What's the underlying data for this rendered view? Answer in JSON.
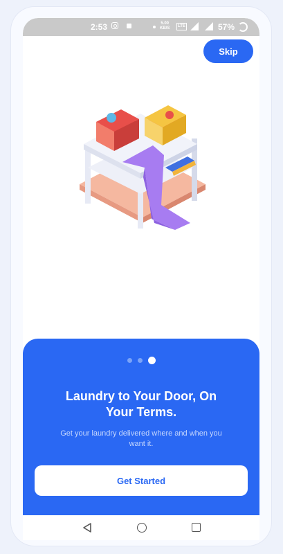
{
  "status_bar": {
    "time": "2:53",
    "net_speed": "5.00\nKB/S",
    "network": "LTE",
    "battery": "57%"
  },
  "header": {
    "skip_label": "Skip"
  },
  "onboarding": {
    "page_count": 3,
    "active_index": 2,
    "title": "Laundry to Your Door, On Your Terms.",
    "subtitle": "Get your laundry delivered where and when you want it.",
    "cta_label": "Get Started"
  },
  "colors": {
    "primary": "#2a68f3",
    "panel_text": "#ffffff",
    "subtitle_text": "#c7d8fd",
    "dot_inactive": "#7aa3f8"
  },
  "icons": [
    "instagram-icon",
    "lock-icon",
    "signal-icon",
    "battery-icon",
    "back-icon",
    "home-icon",
    "recents-icon"
  ]
}
